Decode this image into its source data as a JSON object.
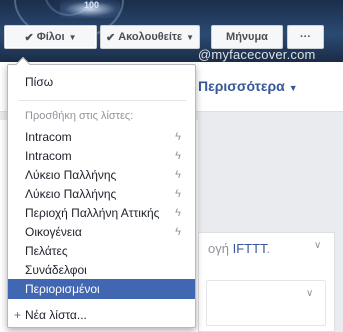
{
  "cover": {
    "badge_text": "100"
  },
  "watermark": "@myfacecover.com",
  "actions": {
    "friends_label": "Φίλοι",
    "follow_label": "Ακολουθείτε",
    "message_label": "Μήνυμα",
    "more_label": "···"
  },
  "nav": {
    "more_label": "Περισσότερα"
  },
  "card": {
    "text_prefix": "ογή ",
    "link": "IFTTT",
    "text_suffix": "."
  },
  "menu": {
    "back_label": "Πίσω",
    "add_to_lists_label": "Προσθήκη στις λίστες:",
    "items": [
      {
        "label": "Intracom",
        "bolt": true
      },
      {
        "label": "Intracom",
        "bolt": true
      },
      {
        "label": "Λύκειο Παλλήνης",
        "bolt": true
      },
      {
        "label": "Λύκειο Παλλήνης",
        "bolt": true
      },
      {
        "label": "Περιοχή Παλλήνη Αττικής",
        "bolt": true
      },
      {
        "label": "Οικογένεια",
        "bolt": true
      },
      {
        "label": "Πελάτες",
        "bolt": false
      },
      {
        "label": "Συνάδελφοι",
        "bolt": false
      },
      {
        "label": "Περιορισμένοι",
        "bolt": false,
        "selected": true
      }
    ],
    "new_list_label": "Νέα λίστα..."
  },
  "colors": {
    "accent": "#4267b2",
    "link": "#365899"
  },
  "icons": {
    "check": "check-icon",
    "bolt": "lightning-bolt-icon",
    "plus": "plus-icon",
    "caret": "caret-down-icon"
  }
}
